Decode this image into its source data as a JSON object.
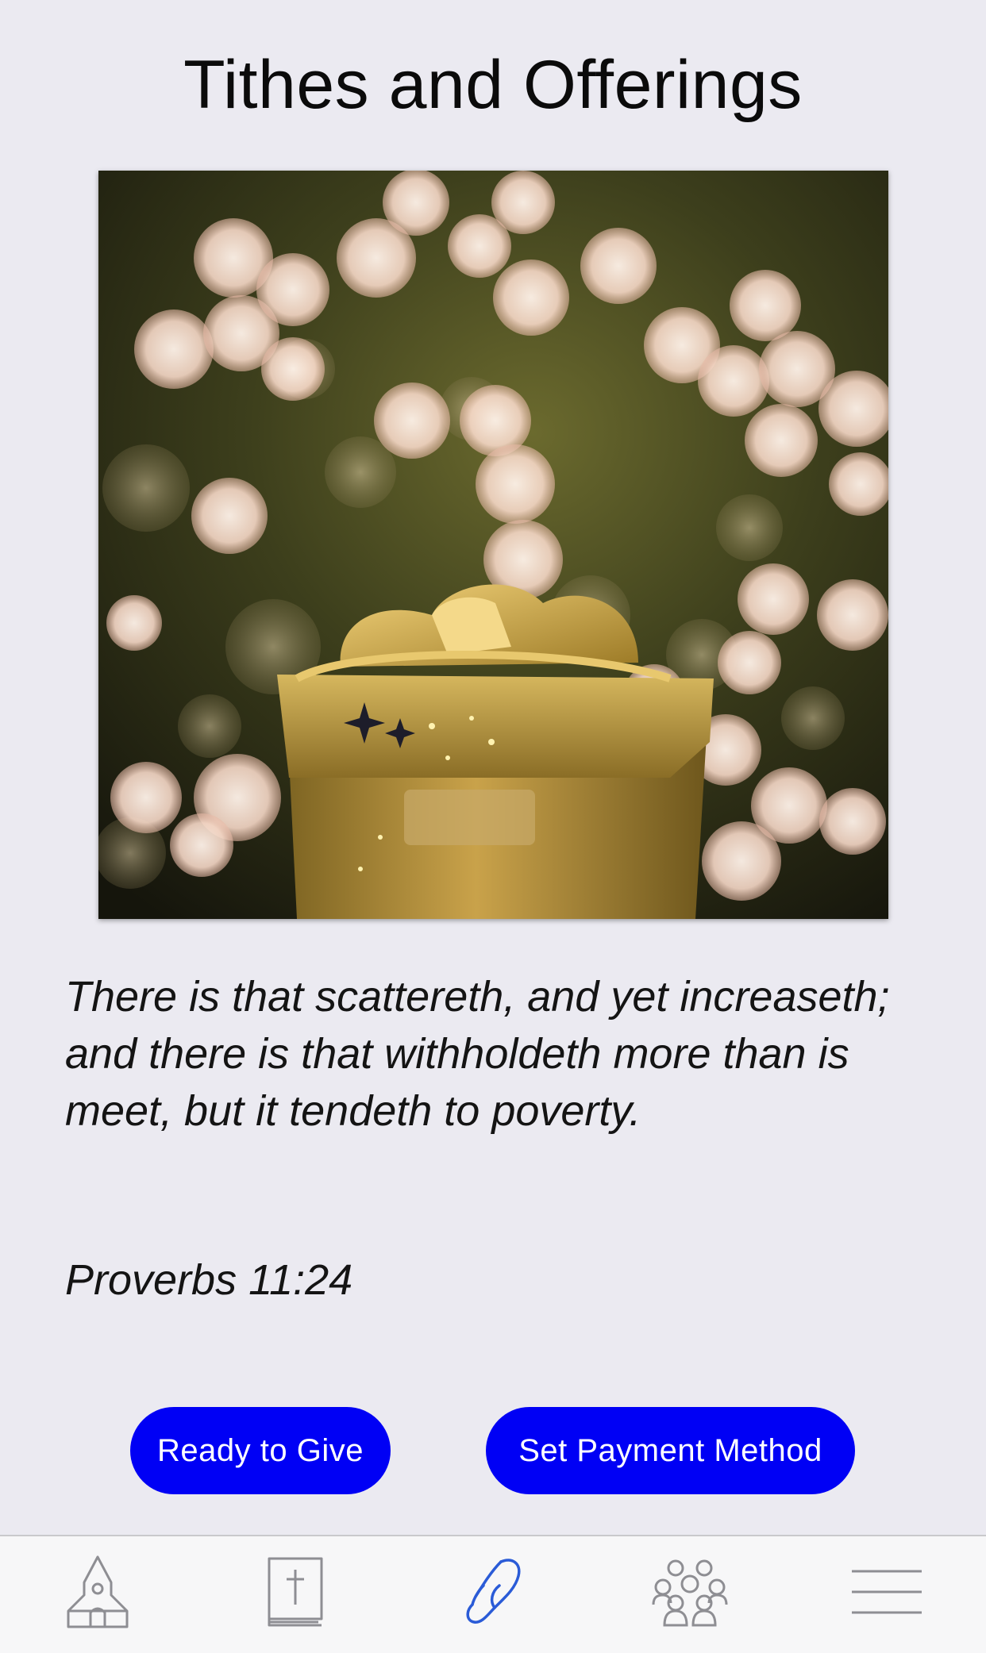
{
  "page": {
    "title": "Tithes and Offerings"
  },
  "hero_image": {
    "description_icon": "gift-bokeh-image"
  },
  "verse": {
    "text": "There is that scattereth, and yet increaseth; and there is that withholdeth more than is meet, but it tendeth to poverty.",
    "reference": "Proverbs 11:24"
  },
  "actions": {
    "ready_label": "Ready to Give",
    "payment_label": "Set Payment Method"
  },
  "tabbar": {
    "items": [
      {
        "icon": "church-icon",
        "active": false
      },
      {
        "icon": "bible-icon",
        "active": false
      },
      {
        "icon": "give-hand-icon",
        "active": true
      },
      {
        "icon": "people-icon",
        "active": false
      },
      {
        "icon": "menu-icon",
        "active": false
      }
    ]
  },
  "colors": {
    "accent": "#0000f5",
    "active_tab": "#2a5bd7",
    "inactive_tab": "#8e8e93",
    "background": "#ebeaf1"
  }
}
